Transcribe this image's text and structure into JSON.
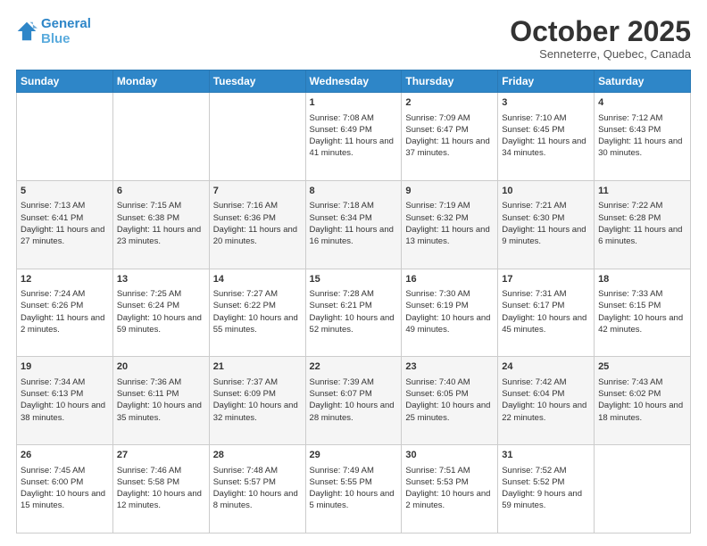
{
  "header": {
    "logo_line1": "General",
    "logo_line2": "Blue",
    "month": "October 2025",
    "location": "Senneterre, Quebec, Canada"
  },
  "weekdays": [
    "Sunday",
    "Monday",
    "Tuesday",
    "Wednesday",
    "Thursday",
    "Friday",
    "Saturday"
  ],
  "weeks": [
    [
      {
        "day": "",
        "text": ""
      },
      {
        "day": "",
        "text": ""
      },
      {
        "day": "",
        "text": ""
      },
      {
        "day": "1",
        "text": "Sunrise: 7:08 AM\nSunset: 6:49 PM\nDaylight: 11 hours and 41 minutes."
      },
      {
        "day": "2",
        "text": "Sunrise: 7:09 AM\nSunset: 6:47 PM\nDaylight: 11 hours and 37 minutes."
      },
      {
        "day": "3",
        "text": "Sunrise: 7:10 AM\nSunset: 6:45 PM\nDaylight: 11 hours and 34 minutes."
      },
      {
        "day": "4",
        "text": "Sunrise: 7:12 AM\nSunset: 6:43 PM\nDaylight: 11 hours and 30 minutes."
      }
    ],
    [
      {
        "day": "5",
        "text": "Sunrise: 7:13 AM\nSunset: 6:41 PM\nDaylight: 11 hours and 27 minutes."
      },
      {
        "day": "6",
        "text": "Sunrise: 7:15 AM\nSunset: 6:38 PM\nDaylight: 11 hours and 23 minutes."
      },
      {
        "day": "7",
        "text": "Sunrise: 7:16 AM\nSunset: 6:36 PM\nDaylight: 11 hours and 20 minutes."
      },
      {
        "day": "8",
        "text": "Sunrise: 7:18 AM\nSunset: 6:34 PM\nDaylight: 11 hours and 16 minutes."
      },
      {
        "day": "9",
        "text": "Sunrise: 7:19 AM\nSunset: 6:32 PM\nDaylight: 11 hours and 13 minutes."
      },
      {
        "day": "10",
        "text": "Sunrise: 7:21 AM\nSunset: 6:30 PM\nDaylight: 11 hours and 9 minutes."
      },
      {
        "day": "11",
        "text": "Sunrise: 7:22 AM\nSunset: 6:28 PM\nDaylight: 11 hours and 6 minutes."
      }
    ],
    [
      {
        "day": "12",
        "text": "Sunrise: 7:24 AM\nSunset: 6:26 PM\nDaylight: 11 hours and 2 minutes."
      },
      {
        "day": "13",
        "text": "Sunrise: 7:25 AM\nSunset: 6:24 PM\nDaylight: 10 hours and 59 minutes."
      },
      {
        "day": "14",
        "text": "Sunrise: 7:27 AM\nSunset: 6:22 PM\nDaylight: 10 hours and 55 minutes."
      },
      {
        "day": "15",
        "text": "Sunrise: 7:28 AM\nSunset: 6:21 PM\nDaylight: 10 hours and 52 minutes."
      },
      {
        "day": "16",
        "text": "Sunrise: 7:30 AM\nSunset: 6:19 PM\nDaylight: 10 hours and 49 minutes."
      },
      {
        "day": "17",
        "text": "Sunrise: 7:31 AM\nSunset: 6:17 PM\nDaylight: 10 hours and 45 minutes."
      },
      {
        "day": "18",
        "text": "Sunrise: 7:33 AM\nSunset: 6:15 PM\nDaylight: 10 hours and 42 minutes."
      }
    ],
    [
      {
        "day": "19",
        "text": "Sunrise: 7:34 AM\nSunset: 6:13 PM\nDaylight: 10 hours and 38 minutes."
      },
      {
        "day": "20",
        "text": "Sunrise: 7:36 AM\nSunset: 6:11 PM\nDaylight: 10 hours and 35 minutes."
      },
      {
        "day": "21",
        "text": "Sunrise: 7:37 AM\nSunset: 6:09 PM\nDaylight: 10 hours and 32 minutes."
      },
      {
        "day": "22",
        "text": "Sunrise: 7:39 AM\nSunset: 6:07 PM\nDaylight: 10 hours and 28 minutes."
      },
      {
        "day": "23",
        "text": "Sunrise: 7:40 AM\nSunset: 6:05 PM\nDaylight: 10 hours and 25 minutes."
      },
      {
        "day": "24",
        "text": "Sunrise: 7:42 AM\nSunset: 6:04 PM\nDaylight: 10 hours and 22 minutes."
      },
      {
        "day": "25",
        "text": "Sunrise: 7:43 AM\nSunset: 6:02 PM\nDaylight: 10 hours and 18 minutes."
      }
    ],
    [
      {
        "day": "26",
        "text": "Sunrise: 7:45 AM\nSunset: 6:00 PM\nDaylight: 10 hours and 15 minutes."
      },
      {
        "day": "27",
        "text": "Sunrise: 7:46 AM\nSunset: 5:58 PM\nDaylight: 10 hours and 12 minutes."
      },
      {
        "day": "28",
        "text": "Sunrise: 7:48 AM\nSunset: 5:57 PM\nDaylight: 10 hours and 8 minutes."
      },
      {
        "day": "29",
        "text": "Sunrise: 7:49 AM\nSunset: 5:55 PM\nDaylight: 10 hours and 5 minutes."
      },
      {
        "day": "30",
        "text": "Sunrise: 7:51 AM\nSunset: 5:53 PM\nDaylight: 10 hours and 2 minutes."
      },
      {
        "day": "31",
        "text": "Sunrise: 7:52 AM\nSunset: 5:52 PM\nDaylight: 9 hours and 59 minutes."
      },
      {
        "day": "",
        "text": ""
      }
    ]
  ]
}
